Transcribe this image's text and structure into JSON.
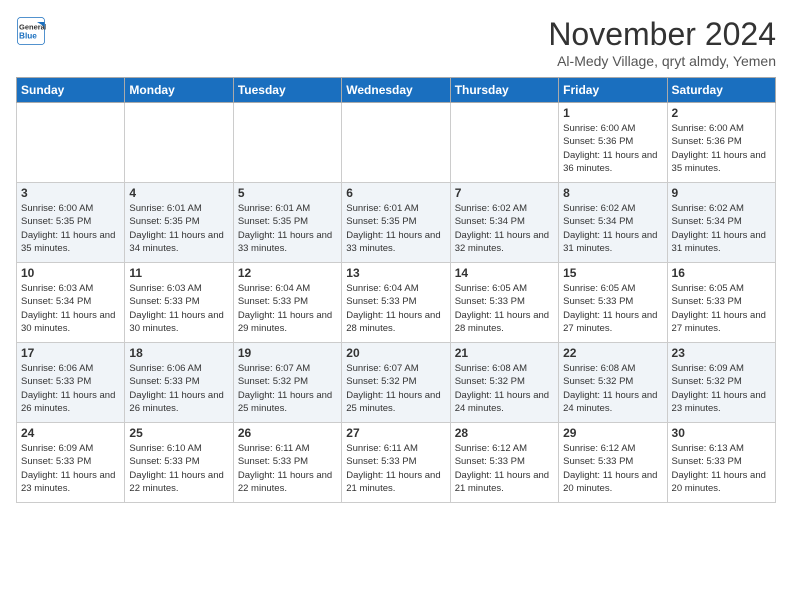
{
  "header": {
    "logo_line1": "General",
    "logo_line2": "Blue",
    "month": "November 2024",
    "location": "Al-Medy Village, qryt almdy, Yemen"
  },
  "days_of_week": [
    "Sunday",
    "Monday",
    "Tuesday",
    "Wednesday",
    "Thursday",
    "Friday",
    "Saturday"
  ],
  "weeks": [
    [
      {
        "day": "",
        "info": ""
      },
      {
        "day": "",
        "info": ""
      },
      {
        "day": "",
        "info": ""
      },
      {
        "day": "",
        "info": ""
      },
      {
        "day": "",
        "info": ""
      },
      {
        "day": "1",
        "info": "Sunrise: 6:00 AM\nSunset: 5:36 PM\nDaylight: 11 hours and 36 minutes."
      },
      {
        "day": "2",
        "info": "Sunrise: 6:00 AM\nSunset: 5:36 PM\nDaylight: 11 hours and 35 minutes."
      }
    ],
    [
      {
        "day": "3",
        "info": "Sunrise: 6:00 AM\nSunset: 5:35 PM\nDaylight: 11 hours and 35 minutes."
      },
      {
        "day": "4",
        "info": "Sunrise: 6:01 AM\nSunset: 5:35 PM\nDaylight: 11 hours and 34 minutes."
      },
      {
        "day": "5",
        "info": "Sunrise: 6:01 AM\nSunset: 5:35 PM\nDaylight: 11 hours and 33 minutes."
      },
      {
        "day": "6",
        "info": "Sunrise: 6:01 AM\nSunset: 5:35 PM\nDaylight: 11 hours and 33 minutes."
      },
      {
        "day": "7",
        "info": "Sunrise: 6:02 AM\nSunset: 5:34 PM\nDaylight: 11 hours and 32 minutes."
      },
      {
        "day": "8",
        "info": "Sunrise: 6:02 AM\nSunset: 5:34 PM\nDaylight: 11 hours and 31 minutes."
      },
      {
        "day": "9",
        "info": "Sunrise: 6:02 AM\nSunset: 5:34 PM\nDaylight: 11 hours and 31 minutes."
      }
    ],
    [
      {
        "day": "10",
        "info": "Sunrise: 6:03 AM\nSunset: 5:34 PM\nDaylight: 11 hours and 30 minutes."
      },
      {
        "day": "11",
        "info": "Sunrise: 6:03 AM\nSunset: 5:33 PM\nDaylight: 11 hours and 30 minutes."
      },
      {
        "day": "12",
        "info": "Sunrise: 6:04 AM\nSunset: 5:33 PM\nDaylight: 11 hours and 29 minutes."
      },
      {
        "day": "13",
        "info": "Sunrise: 6:04 AM\nSunset: 5:33 PM\nDaylight: 11 hours and 28 minutes."
      },
      {
        "day": "14",
        "info": "Sunrise: 6:05 AM\nSunset: 5:33 PM\nDaylight: 11 hours and 28 minutes."
      },
      {
        "day": "15",
        "info": "Sunrise: 6:05 AM\nSunset: 5:33 PM\nDaylight: 11 hours and 27 minutes."
      },
      {
        "day": "16",
        "info": "Sunrise: 6:05 AM\nSunset: 5:33 PM\nDaylight: 11 hours and 27 minutes."
      }
    ],
    [
      {
        "day": "17",
        "info": "Sunrise: 6:06 AM\nSunset: 5:33 PM\nDaylight: 11 hours and 26 minutes."
      },
      {
        "day": "18",
        "info": "Sunrise: 6:06 AM\nSunset: 5:33 PM\nDaylight: 11 hours and 26 minutes."
      },
      {
        "day": "19",
        "info": "Sunrise: 6:07 AM\nSunset: 5:32 PM\nDaylight: 11 hours and 25 minutes."
      },
      {
        "day": "20",
        "info": "Sunrise: 6:07 AM\nSunset: 5:32 PM\nDaylight: 11 hours and 25 minutes."
      },
      {
        "day": "21",
        "info": "Sunrise: 6:08 AM\nSunset: 5:32 PM\nDaylight: 11 hours and 24 minutes."
      },
      {
        "day": "22",
        "info": "Sunrise: 6:08 AM\nSunset: 5:32 PM\nDaylight: 11 hours and 24 minutes."
      },
      {
        "day": "23",
        "info": "Sunrise: 6:09 AM\nSunset: 5:32 PM\nDaylight: 11 hours and 23 minutes."
      }
    ],
    [
      {
        "day": "24",
        "info": "Sunrise: 6:09 AM\nSunset: 5:33 PM\nDaylight: 11 hours and 23 minutes."
      },
      {
        "day": "25",
        "info": "Sunrise: 6:10 AM\nSunset: 5:33 PM\nDaylight: 11 hours and 22 minutes."
      },
      {
        "day": "26",
        "info": "Sunrise: 6:11 AM\nSunset: 5:33 PM\nDaylight: 11 hours and 22 minutes."
      },
      {
        "day": "27",
        "info": "Sunrise: 6:11 AM\nSunset: 5:33 PM\nDaylight: 11 hours and 21 minutes."
      },
      {
        "day": "28",
        "info": "Sunrise: 6:12 AM\nSunset: 5:33 PM\nDaylight: 11 hours and 21 minutes."
      },
      {
        "day": "29",
        "info": "Sunrise: 6:12 AM\nSunset: 5:33 PM\nDaylight: 11 hours and 20 minutes."
      },
      {
        "day": "30",
        "info": "Sunrise: 6:13 AM\nSunset: 5:33 PM\nDaylight: 11 hours and 20 minutes."
      }
    ]
  ]
}
